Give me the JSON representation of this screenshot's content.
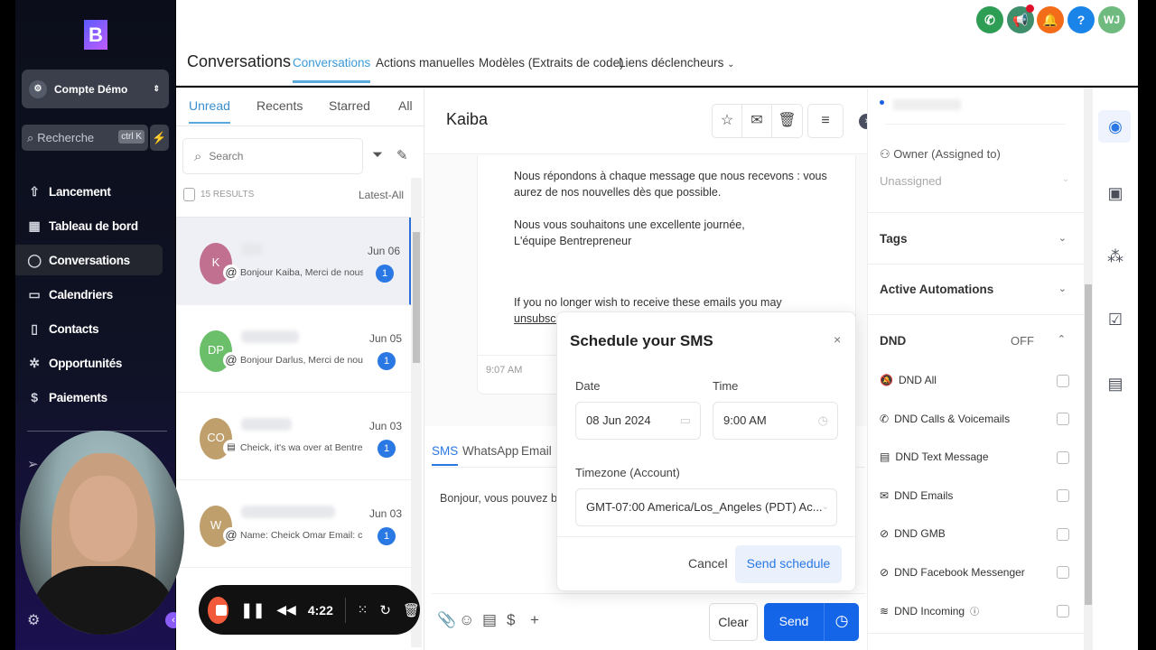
{
  "app": {
    "logo_text": "B"
  },
  "sidebar": {
    "account": "Compte Démo",
    "search_placeholder": "Recherche",
    "search_shortcut": "ctrl K",
    "items": [
      {
        "label": "Lancement",
        "icon": "rocket-icon"
      },
      {
        "label": "Tableau de bord",
        "icon": "dashboard-icon"
      },
      {
        "label": "Conversations",
        "icon": "chat-icon",
        "active": true
      },
      {
        "label": "Calendriers",
        "icon": "calendar-icon"
      },
      {
        "label": "Contacts",
        "icon": "contacts-icon"
      },
      {
        "label": "Opportunités",
        "icon": "opportunities-icon"
      },
      {
        "label": "Paiements",
        "icon": "payments-icon"
      }
    ]
  },
  "topbar": {
    "title": "Conversations",
    "tabs": [
      "Conversations",
      "Actions manuelles",
      "Modèles (Extraits de code)",
      "Liens déclencheurs"
    ],
    "avatar": "WJ",
    "icon_colors": {
      "phone": "#2e9e55",
      "megaphone": "#3f8f6c",
      "bell": "#f26c1a",
      "help": "#1a84e8",
      "avatar": "#6fba7e"
    }
  },
  "list": {
    "tabs": [
      "Unread",
      "Recents",
      "Starred",
      "All"
    ],
    "search_placeholder": "Search",
    "results": "15 RESULTS",
    "sort": "Latest-All",
    "items": [
      {
        "initials": "K",
        "color": "#c2708f",
        "preview": "Bonjour Kaiba, Merci de nous av",
        "date": "Jun 06",
        "unread": "1",
        "channel": "@"
      },
      {
        "initials": "DP",
        "color": "#6bbf6b",
        "preview": "Bonjour Darlus, Merci de nous a",
        "date": "Jun 05",
        "unread": "1",
        "channel": "@"
      },
      {
        "initials": "CO",
        "color": "#bfa06d",
        "preview": "Cheick, it's wa over at Bentrepre",
        "date": "Jun 03",
        "unread": "1",
        "channel": "sms"
      },
      {
        "initials": "W",
        "color": "#bfa06d",
        "preview": "Name: Cheick Omar Email: cheic",
        "date": "Jun 03",
        "unread": "1",
        "channel": "@"
      }
    ]
  },
  "chat": {
    "contact": "Kaiba",
    "message_p1": "Nous répondons à chaque message que nous recevons : vous aurez de nos nouvelles dès que possible.",
    "message_p2a": "Nous vous souhaitons une excellente journée,",
    "message_p2b": "L'équipe Bentrepreneur",
    "unsub_text": "If you no longer wish to receive these emails you may",
    "unsub_link": "unsubscribe",
    "time": "9:07 AM",
    "channel_tabs": [
      "SMS",
      "WhatsApp",
      "Email"
    ],
    "compose_text": "Bonjour, vous pouvez bo",
    "clear": "Clear",
    "send": "Send"
  },
  "modal": {
    "title": "Schedule your SMS",
    "date_label": "Date",
    "date_value": "08 Jun 2024",
    "time_label": "Time",
    "time_value": "9:00 AM",
    "tz_label": "Timezone (Account)",
    "tz_value": "GMT-07:00 America/Los_Angeles (PDT) Ac...",
    "cancel": "Cancel",
    "submit": "Send schedule"
  },
  "contact_panel": {
    "owner_label": "Owner (Assigned to)",
    "owner_value": "Unassigned",
    "tags": "Tags",
    "automations": "Active Automations",
    "dnd": "DND",
    "dnd_state": "OFF",
    "dnd_items": [
      "DND All",
      "DND Calls & Voicemails",
      "DND Text Message",
      "DND Emails",
      "DND GMB",
      "DND Facebook Messenger",
      "DND Incoming"
    ]
  },
  "recorder": {
    "time": "4:22"
  }
}
